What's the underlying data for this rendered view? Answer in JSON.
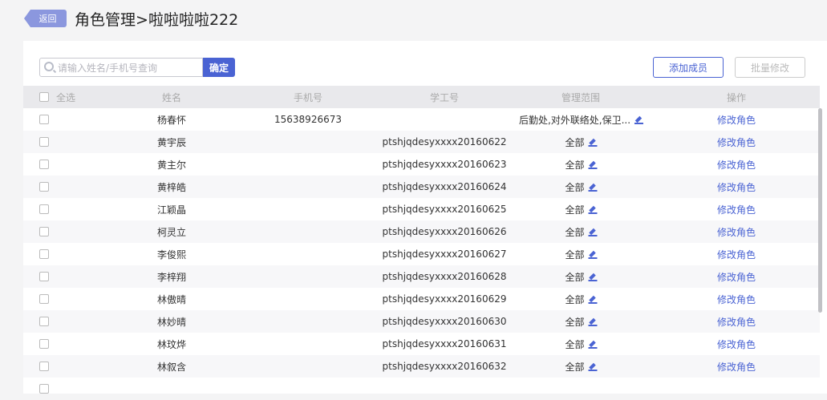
{
  "header": {
    "back_label": "返回",
    "breadcrumb_parent": "角色管理",
    "separator": ">",
    "breadcrumb_current": "啦啦啦啦222"
  },
  "toolbar": {
    "search_placeholder": "请输入姓名/手机号查询",
    "confirm_label": "确定",
    "add_member_label": "添加成员",
    "batch_edit_label": "批量修改"
  },
  "table": {
    "columns": {
      "select_all": "全选",
      "name": "姓名",
      "phone": "手机号",
      "student_id": "学工号",
      "scope": "管理范围",
      "action": "操作"
    },
    "rows": [
      {
        "name": "杨春怀",
        "phone": "15638926673",
        "sid": "",
        "scope": "后勤处,对外联络处,保卫...",
        "action": "修改角色"
      },
      {
        "name": "黄宇辰",
        "phone": "",
        "sid": "ptshjqdesyxxxx20160622",
        "scope": "全部",
        "action": "修改角色"
      },
      {
        "name": "黄主尔",
        "phone": "",
        "sid": "ptshjqdesyxxxx20160623",
        "scope": "全部",
        "action": "修改角色"
      },
      {
        "name": "黄梓皓",
        "phone": "",
        "sid": "ptshjqdesyxxxx20160624",
        "scope": "全部",
        "action": "修改角色"
      },
      {
        "name": "江颖晶",
        "phone": "",
        "sid": "ptshjqdesyxxxx20160625",
        "scope": "全部",
        "action": "修改角色"
      },
      {
        "name": "柯灵立",
        "phone": "",
        "sid": "ptshjqdesyxxxx20160626",
        "scope": "全部",
        "action": "修改角色"
      },
      {
        "name": "李俊熙",
        "phone": "",
        "sid": "ptshjqdesyxxxx20160627",
        "scope": "全部",
        "action": "修改角色"
      },
      {
        "name": "李梓翔",
        "phone": "",
        "sid": "ptshjqdesyxxxx20160628",
        "scope": "全部",
        "action": "修改角色"
      },
      {
        "name": "林傲晴",
        "phone": "",
        "sid": "ptshjqdesyxxxx20160629",
        "scope": "全部",
        "action": "修改角色"
      },
      {
        "name": "林妙晴",
        "phone": "",
        "sid": "ptshjqdesyxxxx20160630",
        "scope": "全部",
        "action": "修改角色"
      },
      {
        "name": "林玟烨",
        "phone": "",
        "sid": "ptshjqdesyxxxx20160631",
        "scope": "全部",
        "action": "修改角色"
      },
      {
        "name": "林叙含",
        "phone": "",
        "sid": "ptshjqdesyxxxx20160632",
        "scope": "全部",
        "action": "修改角色"
      }
    ]
  }
}
